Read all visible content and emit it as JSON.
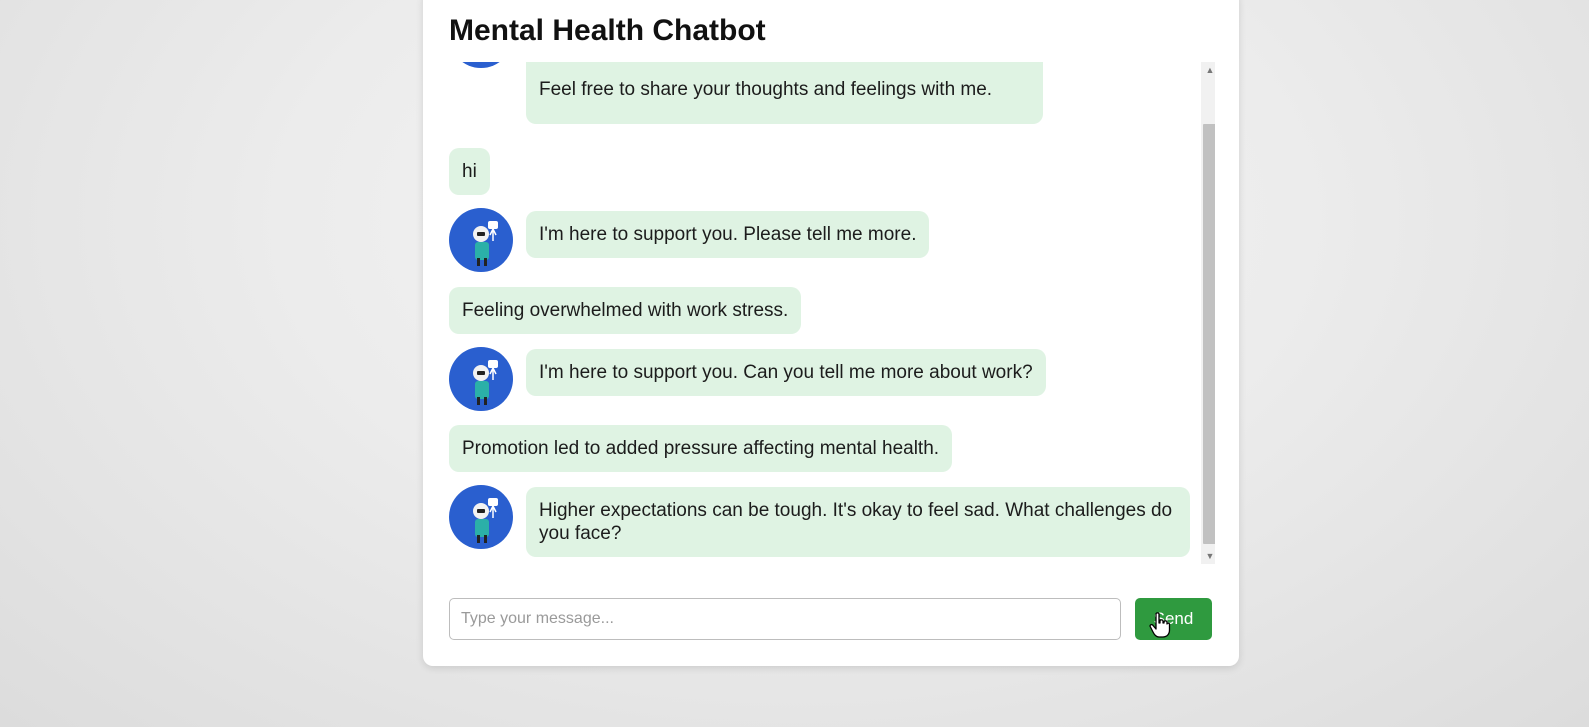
{
  "app": {
    "title": "Mental Health Chatbot"
  },
  "messages": [
    {
      "sender": "bot",
      "text": "Feel free to share your thoughts and feelings with me."
    },
    {
      "sender": "user",
      "text": "hi"
    },
    {
      "sender": "bot",
      "text": "I'm here to support you. Please tell me more."
    },
    {
      "sender": "user",
      "text": "Feeling overwhelmed with work stress."
    },
    {
      "sender": "bot",
      "text": "I'm here to support you. Can you tell me more about work?"
    },
    {
      "sender": "user",
      "text": "Promotion led to added pressure affecting mental health."
    },
    {
      "sender": "bot",
      "text": "Higher expectations can be tough. It's okay to feel sad. What challenges do you face?"
    }
  ],
  "composer": {
    "placeholder": "Type your message...",
    "value": "",
    "send_label": "Send"
  },
  "icons": {
    "avatar": "robot-avatar-icon",
    "scroll_up": "chevron-up-icon",
    "scroll_down": "chevron-down-icon",
    "cursor": "hand-pointer-icon"
  },
  "colors": {
    "bubble": "#dff3e3",
    "send_button": "#2f9a3f",
    "avatar_bg": "#2a5fcf"
  }
}
